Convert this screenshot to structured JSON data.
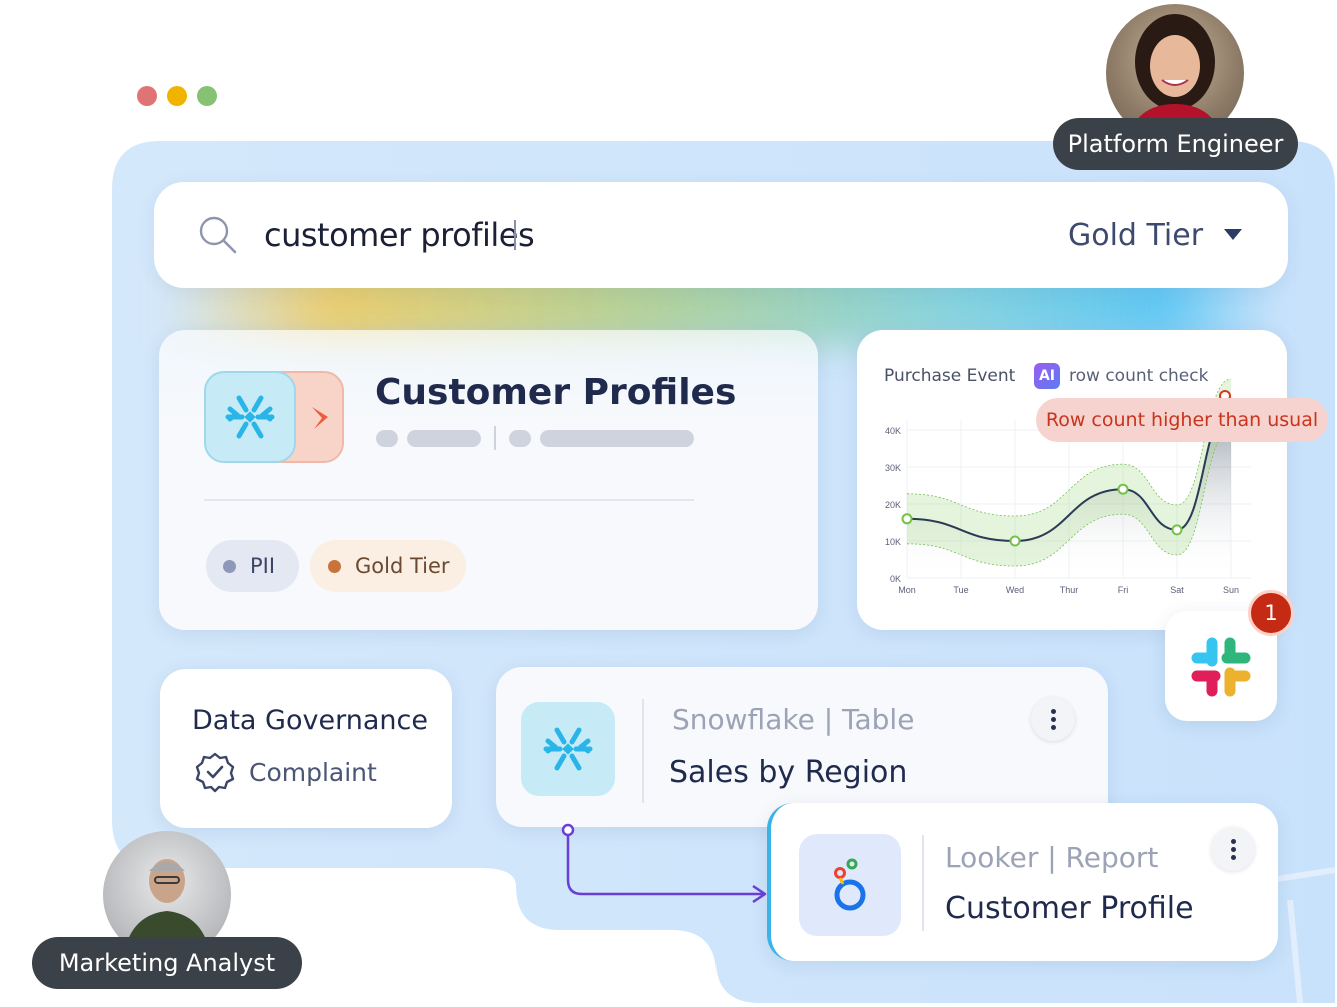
{
  "window_controls": [
    {
      "name": "close",
      "color": "#e07474"
    },
    {
      "name": "minimize",
      "color": "#f0b400"
    },
    {
      "name": "maximize",
      "color": "#86c273"
    }
  ],
  "search": {
    "query": "customer profiles",
    "filter_label": "Gold Tier",
    "icon": "search-icon"
  },
  "asset_card": {
    "title": "Customer Profiles",
    "icon": "snowflake-icon",
    "tags": [
      {
        "label": "PII",
        "dot_color": "#8e98b8",
        "bg": "#e4e8f2"
      },
      {
        "label": "Gold Tier",
        "dot_color": "#c8733c",
        "bg": "#fbeee2"
      }
    ]
  },
  "chart_card": {
    "title": "Purchase Event",
    "ai_badge": "AI",
    "subtitle": "row count check",
    "alert": "Row count higher than usual"
  },
  "chart_data": {
    "type": "line",
    "categories": [
      "Mon",
      "Tue",
      "Wed",
      "Thur",
      "Fri",
      "Sat",
      "Sun"
    ],
    "y_ticks": [
      "0K",
      "10K",
      "20K",
      "30K",
      "40K"
    ],
    "ylim": [
      0,
      40000
    ],
    "series": [
      {
        "values": [
          16000,
          null,
          10000,
          null,
          24000,
          13000,
          47000
        ]
      }
    ],
    "grid": true
  },
  "slack": {
    "icon": "slack-icon",
    "badge_count": "1"
  },
  "governance_card": {
    "title": "Data Governance",
    "status": "Complaint",
    "icon": "verified-badge-icon"
  },
  "snowflake_card": {
    "meta": "Snowflake |  Table",
    "name": "Sales by Region",
    "icon": "snowflake-icon"
  },
  "looker_card": {
    "meta": "Looker | Report",
    "name": "Customer Profile",
    "icon": "looker-icon"
  },
  "people": [
    {
      "role": "Platform Engineer"
    },
    {
      "role": "Marketing Analyst"
    }
  ],
  "colors": {
    "panel_blue": "#cfe5fb",
    "accent_purple": "#6b3fd6",
    "alert_red": "#c8341c",
    "snowflake_blue": "#29b5e8"
  }
}
